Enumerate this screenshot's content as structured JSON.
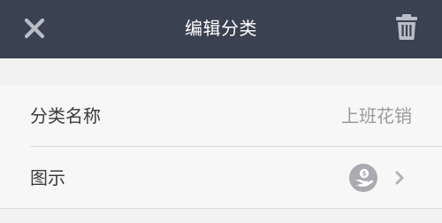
{
  "header": {
    "title": "编辑分类",
    "close_icon": "close-icon",
    "delete_icon": "trash-icon"
  },
  "fields": {
    "name": {
      "label": "分类名称",
      "value": "上班花销"
    },
    "icon": {
      "label": "图示",
      "icon_name": "hand-money-icon",
      "chevron_icon": "chevron-right-icon"
    }
  },
  "colors": {
    "header_bg": "#3a4150",
    "page_bg": "#f2f2f2",
    "icon_circle": "#a9abb0"
  }
}
